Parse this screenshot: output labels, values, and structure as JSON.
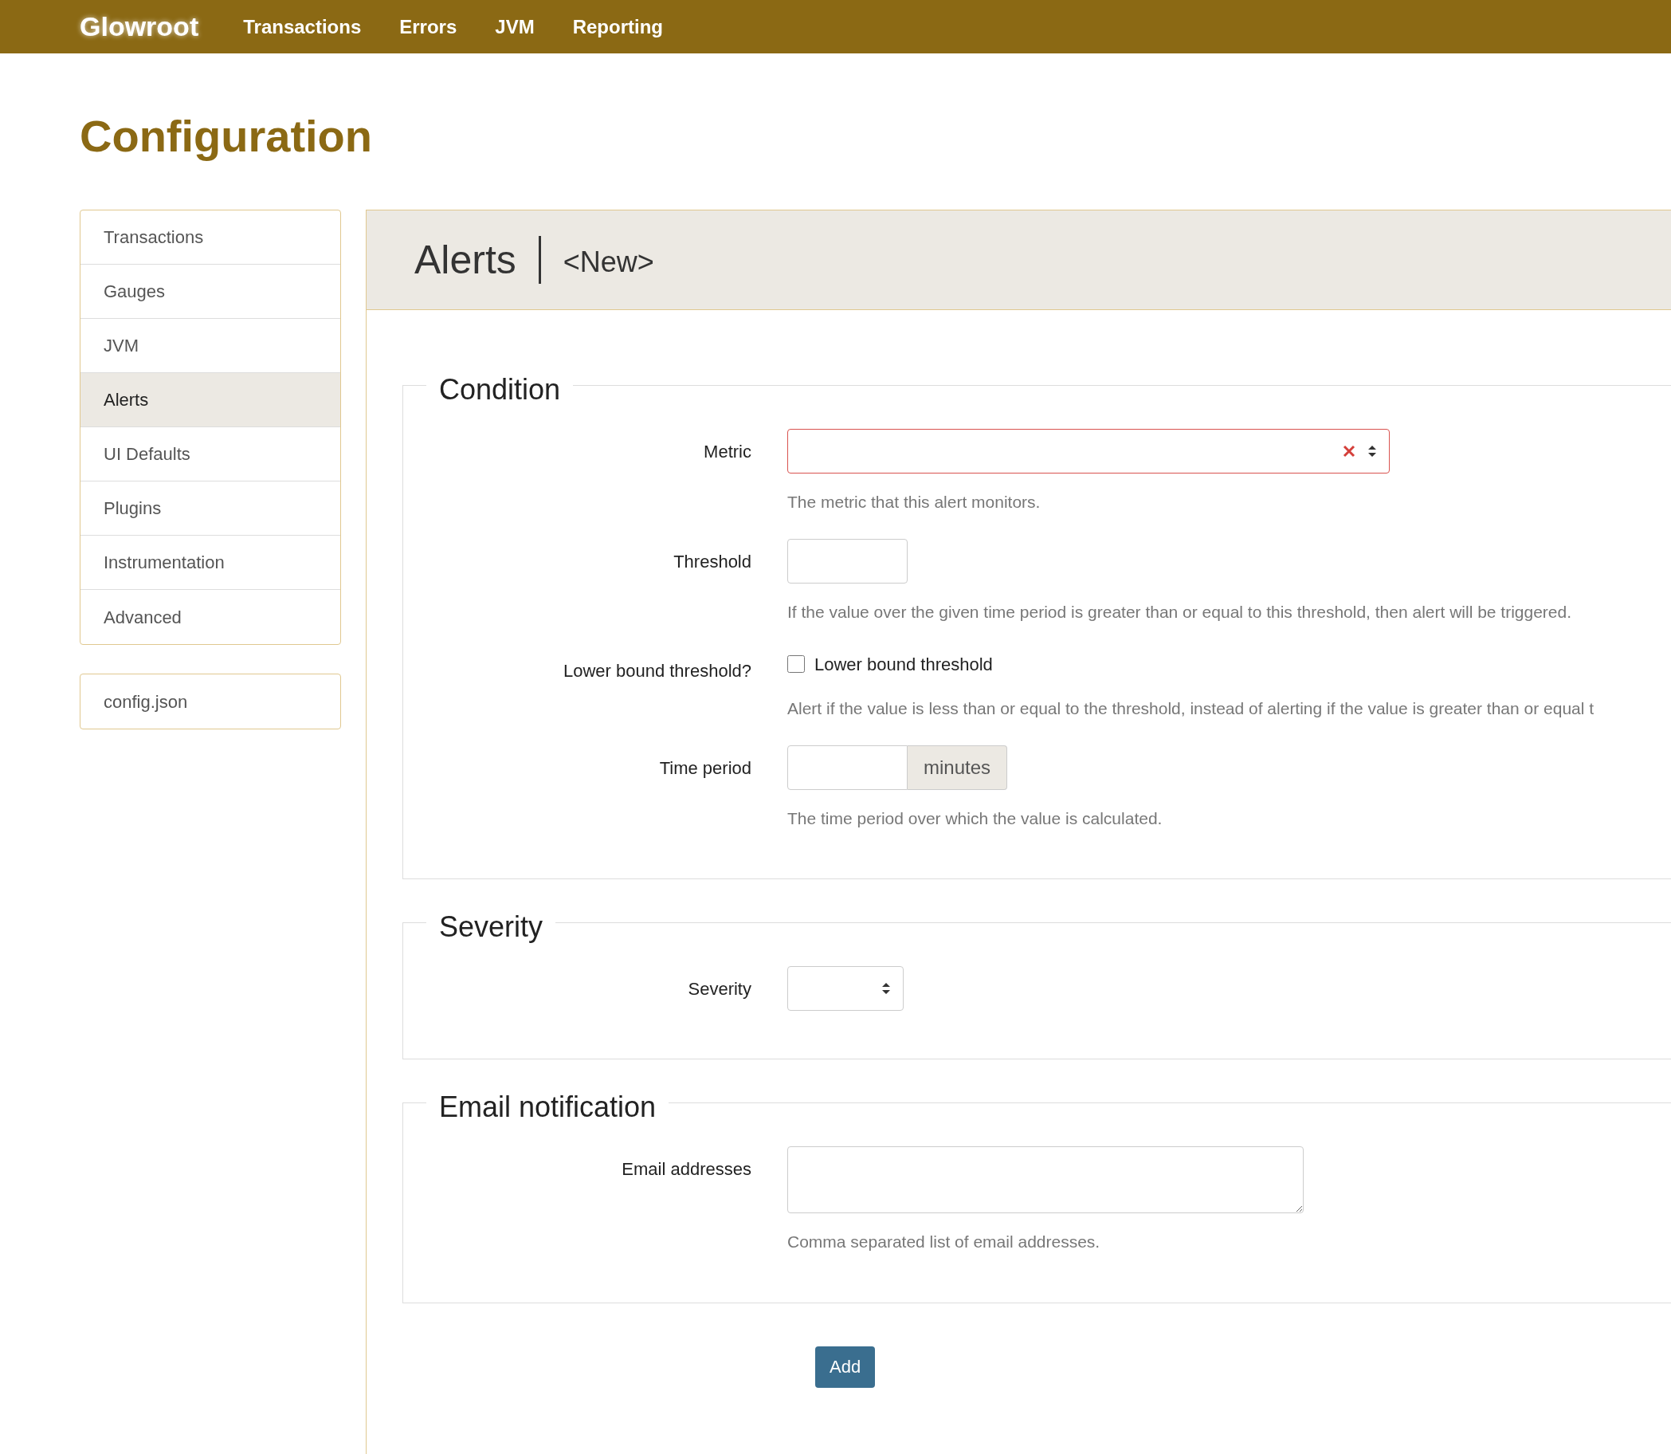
{
  "navbar": {
    "brand": "Glowroot",
    "items": [
      "Transactions",
      "Errors",
      "JVM",
      "Reporting"
    ]
  },
  "page_title": "Configuration",
  "sidebar": {
    "items": [
      {
        "label": "Transactions",
        "selected": false
      },
      {
        "label": "Gauges",
        "selected": false
      },
      {
        "label": "JVM",
        "selected": false
      },
      {
        "label": "Alerts",
        "selected": true
      },
      {
        "label": "UI Defaults",
        "selected": false
      },
      {
        "label": "Plugins",
        "selected": false
      },
      {
        "label": "Instrumentation",
        "selected": false
      },
      {
        "label": "Advanced",
        "selected": false
      }
    ],
    "extra": "config.json"
  },
  "panel": {
    "title": "Alerts",
    "subtitle": "<New>"
  },
  "sections": [
    {
      "legend": "Condition",
      "fields": [
        {
          "kind": "select",
          "label": "Metric",
          "invalid": true,
          "clearable": true,
          "help": "The metric that this alert monitors."
        },
        {
          "kind": "input",
          "label": "Threshold",
          "help": "If the value over the given time period is greater than or equal to this threshold, then alert will be triggered."
        },
        {
          "kind": "checkbox",
          "label": "Lower bound threshold?",
          "checkbox_label": "Lower bound threshold",
          "checked": false,
          "help": "Alert if the value is less than or equal to the threshold, instead of alerting if the value is greater than or equal t"
        },
        {
          "kind": "addon",
          "label": "Time period",
          "addon": "minutes",
          "help": "The time period over which the value is calculated."
        }
      ]
    },
    {
      "legend": "Severity",
      "fields": [
        {
          "kind": "smallselect",
          "label": "Severity"
        }
      ]
    },
    {
      "legend": "Email notification",
      "fields": [
        {
          "kind": "textarea",
          "label": "Email addresses",
          "help": "Comma separated list of email addresses."
        }
      ]
    }
  ],
  "submit": "Add"
}
